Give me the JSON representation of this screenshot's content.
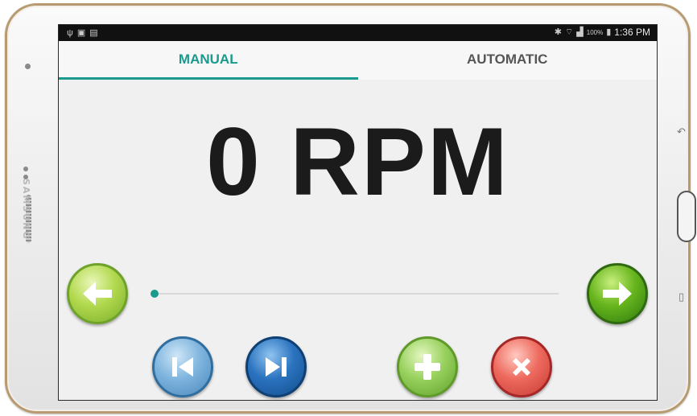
{
  "device": {
    "brand": "SAMSUNG"
  },
  "status_bar": {
    "icons_left": [
      "usb-icon",
      "image-icon",
      "notification-icon"
    ],
    "icons_right": [
      "bluetooth-icon",
      "wifi-icon",
      "signal-icon",
      "battery-icon"
    ],
    "battery_percent": "100%",
    "time": "1:36 PM"
  },
  "tabs": [
    {
      "label": "MANUAL",
      "selected": true
    },
    {
      "label": "AUTOMATIC",
      "selected": false
    }
  ],
  "display": {
    "rpm_text": "0 RPM"
  },
  "slider": {
    "value": 0
  },
  "controls": {
    "left_arrow": "arrow-left-icon",
    "right_arrow": "arrow-right-icon",
    "previous": "skip-previous-icon",
    "next": "skip-next-icon",
    "add": "plus-icon",
    "delete": "close-icon"
  },
  "colors": {
    "accent": "#1a9a8c",
    "text": "#1b1b1b"
  }
}
